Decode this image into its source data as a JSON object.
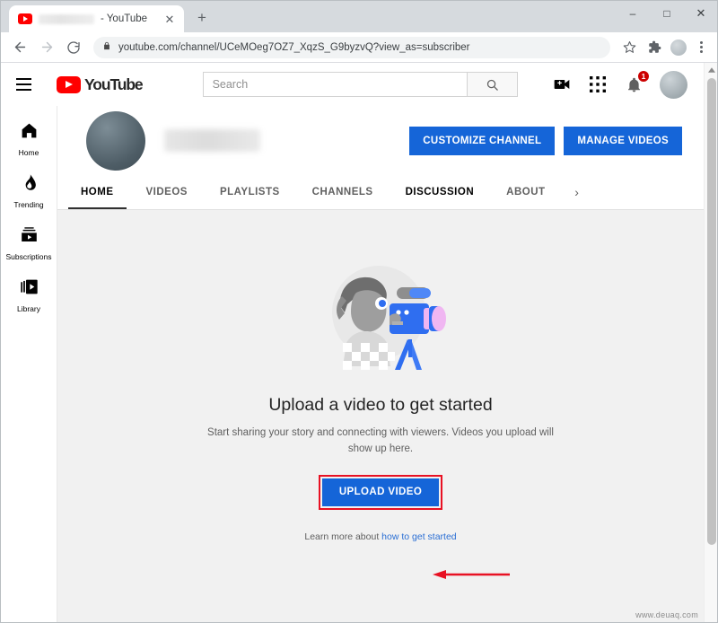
{
  "browser": {
    "tab": {
      "title_suffix": "- YouTube",
      "close_label": "✕"
    },
    "new_tab_label": "+",
    "window_controls": {
      "minimize": "–",
      "maximize": "□",
      "close": "✕"
    },
    "toolbar": {
      "back_label": "←",
      "forward_label": "→",
      "reload_label": "⟳",
      "url": "youtube.com/channel/UCeMOeg7OZ7_XqzS_G9byzvQ?view_as=subscriber",
      "bookmark_label": "☆",
      "extensions_label": "puzzle",
      "menu_label": "⋮"
    }
  },
  "masthead": {
    "logo_text": "YouTube",
    "search": {
      "placeholder": "Search",
      "value": ""
    },
    "notification_count": "1"
  },
  "guide": {
    "items": [
      {
        "label": "Home",
        "icon": "home-icon"
      },
      {
        "label": "Trending",
        "icon": "flame-icon"
      },
      {
        "label": "Subscriptions",
        "icon": "subscriptions-icon"
      },
      {
        "label": "Library",
        "icon": "library-icon"
      }
    ]
  },
  "channel": {
    "actions": [
      {
        "label": "CUSTOMIZE CHANNEL"
      },
      {
        "label": "MANAGE VIDEOS"
      }
    ],
    "tabs": [
      {
        "label": "HOME",
        "active": true
      },
      {
        "label": "VIDEOS",
        "active": false
      },
      {
        "label": "PLAYLISTS",
        "active": false
      },
      {
        "label": "CHANNELS",
        "active": false
      },
      {
        "label": "DISCUSSION",
        "active": false
      },
      {
        "label": "ABOUT",
        "active": false
      }
    ],
    "tabs_more_label": "›"
  },
  "empty_state": {
    "title": "Upload a video to get started",
    "subtitle": "Start sharing your story and connecting with viewers. Videos you upload will show up here.",
    "upload_button": "UPLOAD VIDEO",
    "learn_more_prefix": "Learn more about ",
    "learn_more_link": "how to get started"
  },
  "annotation": {
    "accent_color": "#e81123"
  },
  "watermark": "www.deuaq.com"
}
